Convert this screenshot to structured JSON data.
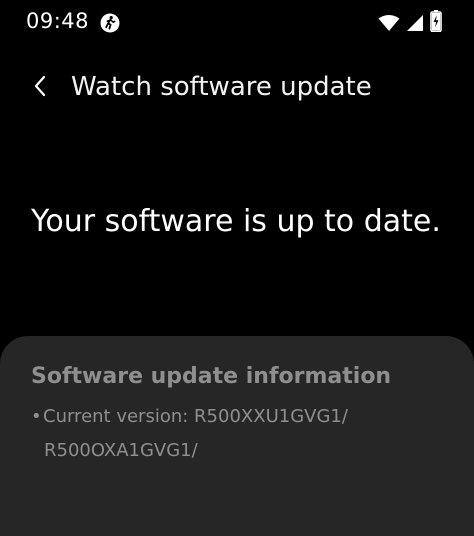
{
  "status_bar": {
    "time": "09:48",
    "icons": {
      "activity": "running-person-icon",
      "wifi": "wifi-icon",
      "signal": "cellular-signal-icon",
      "battery": "battery-charging-icon"
    }
  },
  "header": {
    "back_icon": "chevron-left-icon",
    "title": "Watch software update"
  },
  "main": {
    "status_message": "Your software is up to date."
  },
  "info_card": {
    "title": "Software update information",
    "bullet": "•",
    "version_label": "Current version: R500XXU1GVG1/",
    "version_continuation": "R500OXA1GVG1/"
  },
  "colors": {
    "background": "#000000",
    "card_background": "#262626",
    "primary_text": "#ffffff",
    "secondary_text": "#8f8f8f"
  }
}
